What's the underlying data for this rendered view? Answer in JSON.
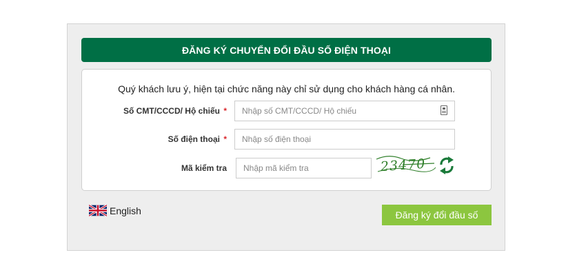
{
  "header": {
    "title": "ĐĂNG KÝ CHUYỂN ĐỔI ĐẦU SỐ ĐIỆN THOẠI"
  },
  "form": {
    "notice": "Quý khách lưu ý, hiện tại chức năng này chỉ sử dụng cho khách hàng cá nhân.",
    "id_field": {
      "label": "Số CMT/CCCD/ Hộ chiếu",
      "required_mark": "*",
      "placeholder": "Nhập số CMT/CCCD/ Hộ chiếu",
      "value": "",
      "icon": "id-card-icon"
    },
    "phone_field": {
      "label": "Số điện thoại",
      "required_mark": "*",
      "placeholder": "Nhập số điện thoại",
      "value": ""
    },
    "captcha_field": {
      "label": "Mã kiểm tra",
      "placeholder": "Nhập mã kiểm tra",
      "value": "",
      "captcha_text": "23470",
      "refresh_icon": "refresh-icon"
    }
  },
  "footer": {
    "language_label": "English",
    "flag_icon": "uk-flag-icon",
    "submit_label": "Đăng ký đổi đầu số"
  },
  "colors": {
    "brand_green": "#006f45",
    "button_green": "#8cc63f",
    "required_red": "#d9262b",
    "panel_bg": "#eeeeee"
  }
}
